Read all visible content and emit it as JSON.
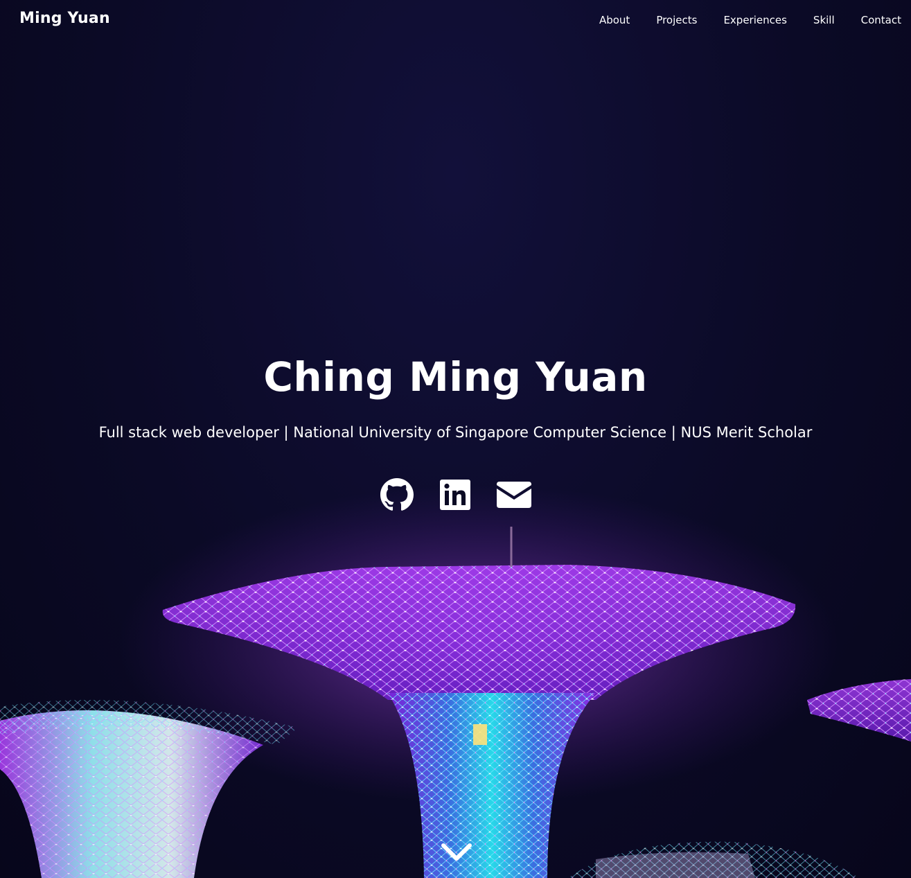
{
  "navbar": {
    "brand": "Ming Yuan",
    "links": [
      {
        "label": "About"
      },
      {
        "label": "Projects"
      },
      {
        "label": "Experiences"
      },
      {
        "label": "Skill"
      },
      {
        "label": "Contact"
      }
    ]
  },
  "hero": {
    "title": "Ching Ming Yuan",
    "subtitle": "Full stack web developer | National University of Singapore Computer Science | NUS Merit Scholar",
    "socials": [
      {
        "icon": "github-icon"
      },
      {
        "icon": "linkedin-icon"
      },
      {
        "icon": "envelope-icon"
      }
    ],
    "scroll_icon": "chevron-down-icon",
    "background": "supertree-grove-night-photo"
  },
  "colors": {
    "background": "#0b0a24",
    "text": "#ffffff",
    "accent_purple": "#b24dff",
    "accent_cyan": "#4fe3ff"
  }
}
